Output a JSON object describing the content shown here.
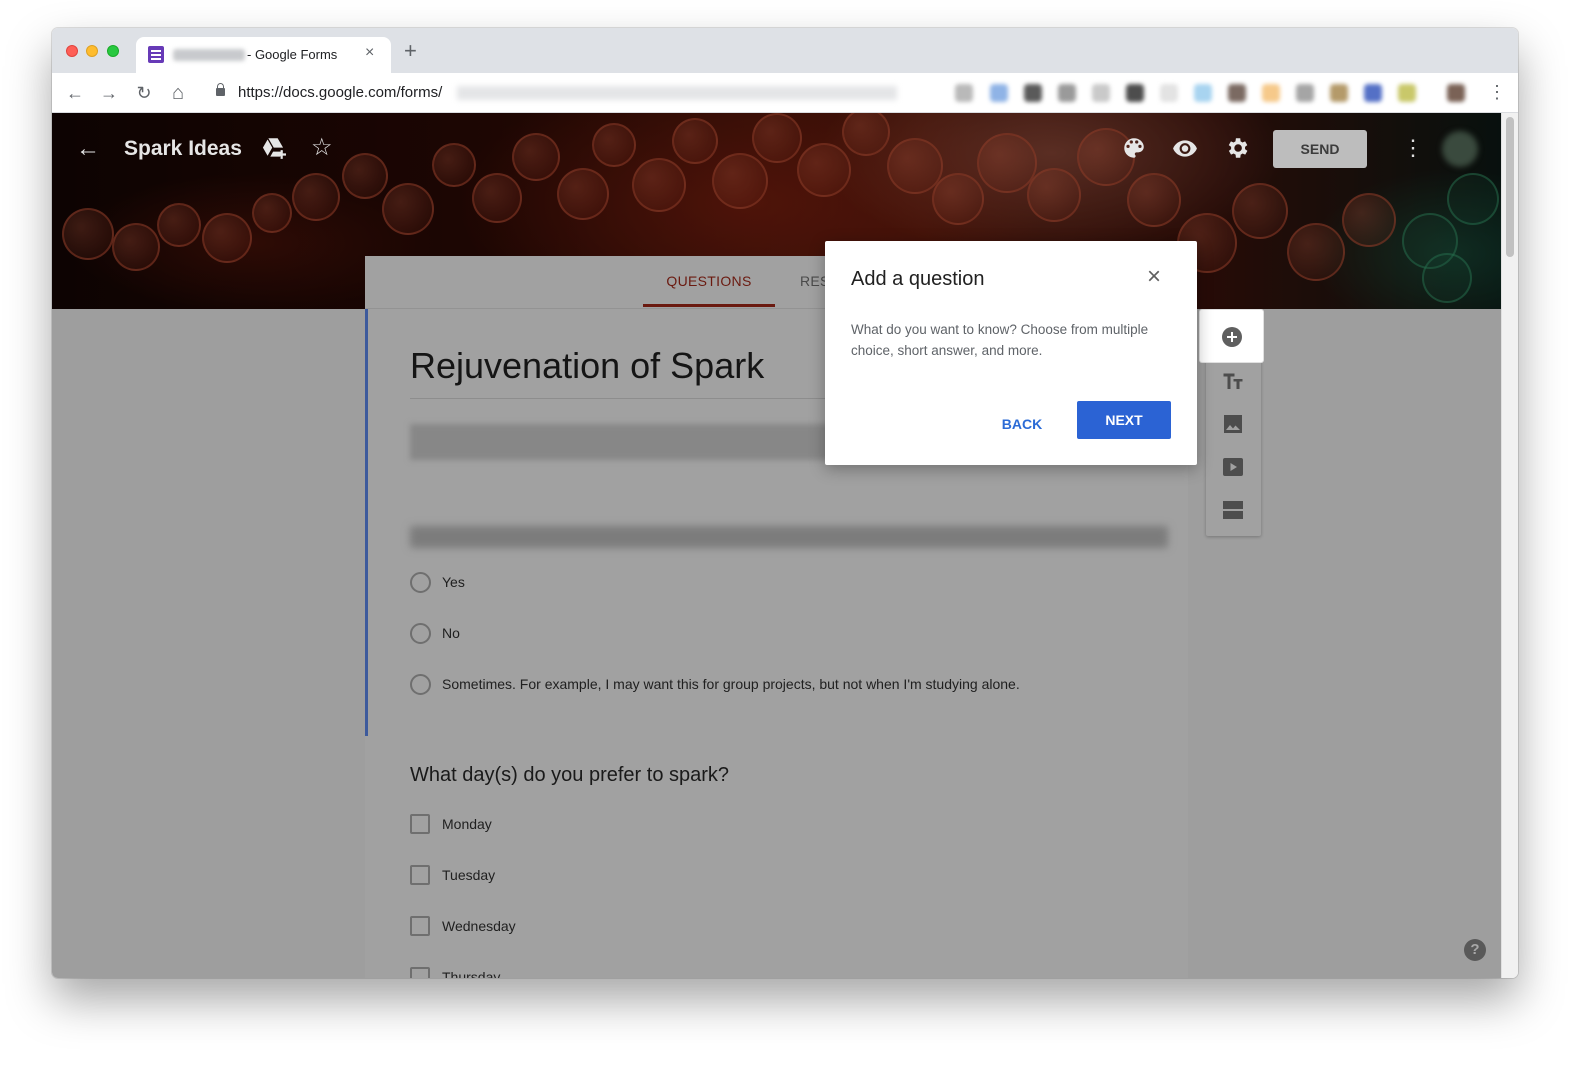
{
  "browser": {
    "tab_title": "- Google Forms",
    "tab_close": "×",
    "new_tab": "+",
    "url_prefix": "https://",
    "url_host": "docs.google.com",
    "url_path": "/forms/",
    "back": "←",
    "forward": "→",
    "reload": "↻",
    "home": "⌂",
    "menu": "⋮"
  },
  "header": {
    "back_icon": "←",
    "title": "Spark Ideas",
    "star_icon": "☆",
    "send_label": "SEND",
    "more_icon": "⋮"
  },
  "form": {
    "tab_questions": "QUESTIONS",
    "tab_responses": "RES",
    "title": "Rejuvenation of Spark",
    "question1_options": [
      "Yes",
      "No",
      "Sometimes.  For example, I may want this for group projects, but not when I'm studying alone."
    ],
    "question2_title": "What day(s) do you prefer to spark?",
    "question2_options": [
      "Monday",
      "Tuesday",
      "Wednesday",
      "Thursday"
    ]
  },
  "dialog": {
    "title": "Add a question",
    "close_icon": "×",
    "body": "What do you want to know? Choose from multiple choice, short answer, and more.",
    "back_label": "BACK",
    "next_label": "NEXT"
  },
  "help": {
    "label": "?"
  },
  "colors": {
    "accent_brand": "#673ab7",
    "questions_tab": "#6b1a10",
    "dialog_primary": "#2b63d4",
    "form_accent": "#3d5a9c"
  },
  "icons": [
    "forms-icon",
    "lock-icon",
    "drive-add-icon",
    "star-icon",
    "palette-icon",
    "eye-icon",
    "gear-icon",
    "add-circle-icon",
    "title-text-icon",
    "image-icon",
    "video-icon",
    "section-icon",
    "help-icon",
    "close-icon"
  ]
}
